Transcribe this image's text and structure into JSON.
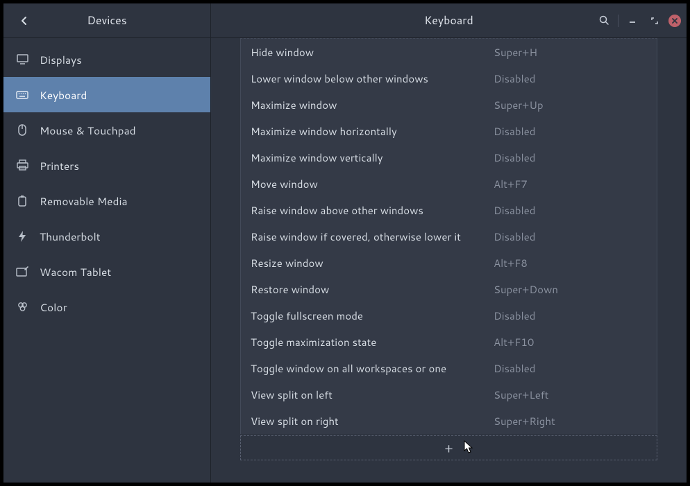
{
  "sidebar": {
    "title": "Devices",
    "items": [
      {
        "label": "Displays",
        "icon": "displays"
      },
      {
        "label": "Keyboard",
        "icon": "keyboard"
      },
      {
        "label": "Mouse & Touchpad",
        "icon": "mouse"
      },
      {
        "label": "Printers",
        "icon": "printer"
      },
      {
        "label": "Removable Media",
        "icon": "removable"
      },
      {
        "label": "Thunderbolt",
        "icon": "thunderbolt"
      },
      {
        "label": "Wacom Tablet",
        "icon": "wacom"
      },
      {
        "label": "Color",
        "icon": "color"
      }
    ],
    "active_index": 1
  },
  "main": {
    "title": "Keyboard"
  },
  "shortcuts": [
    {
      "name": "Hide window",
      "value": "Super+H"
    },
    {
      "name": "Lower window below other windows",
      "value": "Disabled"
    },
    {
      "name": "Maximize window",
      "value": "Super+Up"
    },
    {
      "name": "Maximize window horizontally",
      "value": "Disabled"
    },
    {
      "name": "Maximize window vertically",
      "value": "Disabled"
    },
    {
      "name": "Move window",
      "value": "Alt+F7"
    },
    {
      "name": "Raise window above other windows",
      "value": "Disabled"
    },
    {
      "name": "Raise window if covered, otherwise lower it",
      "value": "Disabled"
    },
    {
      "name": "Resize window",
      "value": "Alt+F8"
    },
    {
      "name": "Restore window",
      "value": "Super+Down"
    },
    {
      "name": "Toggle fullscreen mode",
      "value": "Disabled"
    },
    {
      "name": "Toggle maximization state",
      "value": "Alt+F10"
    },
    {
      "name": "Toggle window on all workspaces or one",
      "value": "Disabled"
    },
    {
      "name": "View split on left",
      "value": "Super+Left"
    },
    {
      "name": "View split on right",
      "value": "Super+Right"
    }
  ],
  "add_label": "+"
}
